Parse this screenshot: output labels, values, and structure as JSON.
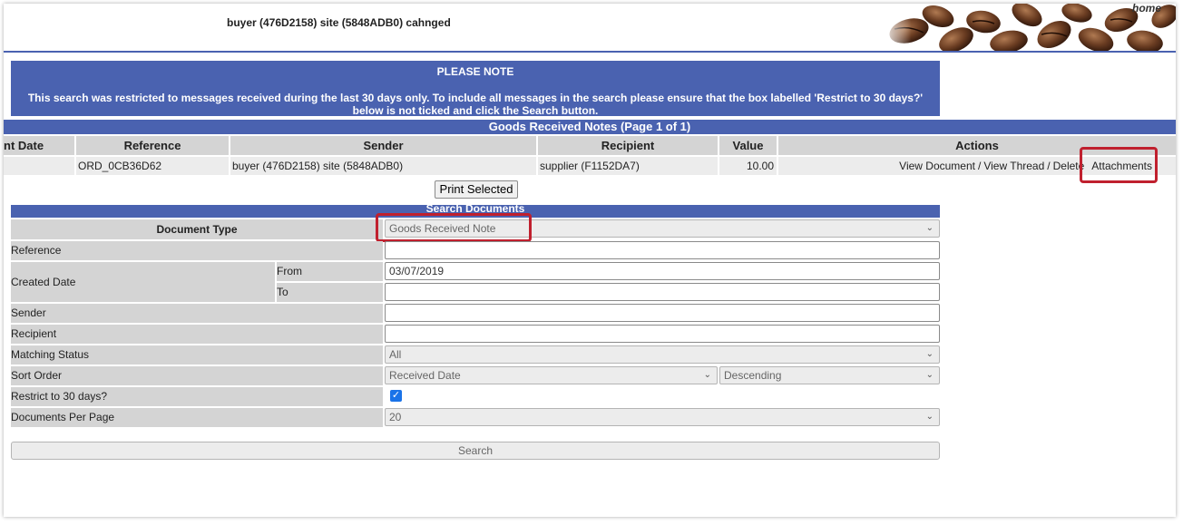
{
  "header": {
    "title": "buyer (476D2158) site (5848ADB0) cahnged",
    "home_link": "home"
  },
  "notice": {
    "title": "PLEASE NOTE",
    "body": "This search was restricted to messages received during the last 30 days only. To include all messages in the search please ensure that the box labelled 'Restrict to 30 days?' below is not ticked and click the Search button."
  },
  "results": {
    "title": "Goods Received Notes (Page 1 of 1)",
    "columns": [
      "nt Date",
      "Reference",
      "Sender",
      "Recipient",
      "Value",
      "Actions"
    ],
    "rows": [
      {
        "date": "",
        "reference": "ORD_0CB36D62",
        "sender": "buyer (476D2158) site (5848ADB0)",
        "recipient": "supplier (F1152DA7)",
        "value": "10.00",
        "actions": [
          "View Document",
          "View Thread",
          "Delete",
          "Attachments"
        ],
        "separator": "/"
      }
    ],
    "print_button": "Print Selected"
  },
  "search": {
    "title": "Search Documents",
    "document_type": {
      "label": "Document Type",
      "value": "Goods Received Note"
    },
    "reference": {
      "label": "Reference",
      "value": ""
    },
    "created_date": {
      "label": "Created Date",
      "from_label": "From",
      "from_value": "03/07/2019",
      "to_label": "To",
      "to_value": ""
    },
    "sender": {
      "label": "Sender",
      "value": ""
    },
    "recipient": {
      "label": "Recipient",
      "value": ""
    },
    "matching_status": {
      "label": "Matching Status",
      "value": "All"
    },
    "sort_order": {
      "label": "Sort Order",
      "field": "Received Date",
      "direction": "Descending"
    },
    "restrict": {
      "label": "Restrict to 30 days?",
      "checked": true
    },
    "per_page": {
      "label": "Documents Per Page",
      "value": "20"
    },
    "search_button": "Search"
  },
  "colors": {
    "accent_blue": "#4a62b0",
    "highlight_red": "#c0202e",
    "header_gray": "#d4d4d4",
    "checkbox_blue": "#1a73e8"
  }
}
